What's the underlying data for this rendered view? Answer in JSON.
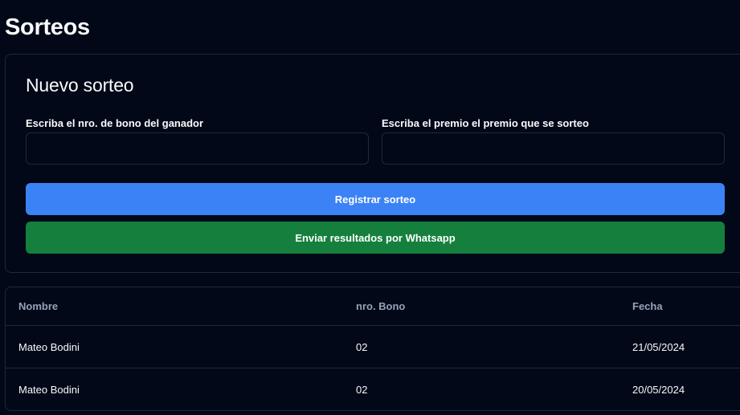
{
  "page": {
    "title": "Sorteos"
  },
  "form": {
    "title": "Nuevo sorteo",
    "bono_label": "Escriba el nro. de bono del ganador",
    "bono_value": "",
    "premio_label": "Escriba el premio el premio que se sorteo",
    "premio_value": "",
    "register_label": "Registrar sorteo",
    "whatsapp_label": "Enviar resultados por Whatsapp"
  },
  "table": {
    "headers": [
      "Nombre",
      "nro. Bono",
      "Fecha"
    ],
    "rows": [
      [
        "Mateo Bodini",
        "02",
        "21/05/2024"
      ],
      [
        "Mateo Bodini",
        "02",
        "20/05/2024"
      ]
    ]
  },
  "colors": {
    "background": "#020817",
    "border": "#1e293b",
    "primary": "#3b82f6",
    "success": "#15803d",
    "muted_text": "#94a3b8"
  }
}
